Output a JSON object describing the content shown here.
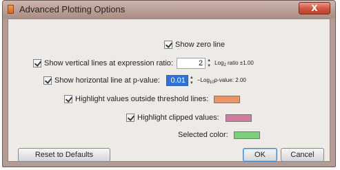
{
  "dialog": {
    "title": "Advanced Plotting Options",
    "close_glyph": "X"
  },
  "options": {
    "show_zero_line": {
      "label": "Show zero line",
      "checked": true
    },
    "vertical_lines": {
      "label": "Show vertical lines at expression ratio:",
      "checked": true,
      "value": "2",
      "unit_prefix": "Log",
      "unit_sub": "2",
      "unit_suffix": " ratio  ±1.00"
    },
    "horizontal_line": {
      "label": "Show horizontal line at p-value:",
      "checked": true,
      "value": "0.01",
      "unit_prefix": "−Log",
      "unit_sub": "10",
      "unit_suffix": "p-value: 2.00"
    },
    "highlight_outside": {
      "label": "Highlight values outside threshold lines:",
      "checked": true,
      "color": "#e8956a"
    },
    "highlight_clipped": {
      "label": "Highlight clipped values:",
      "checked": true,
      "color": "#d27aa0"
    },
    "selected_color": {
      "label": "Selected color:",
      "color": "#7ccf7a"
    }
  },
  "buttons": {
    "reset": "Reset to Defaults",
    "ok": "OK",
    "cancel": "Cancel"
  }
}
